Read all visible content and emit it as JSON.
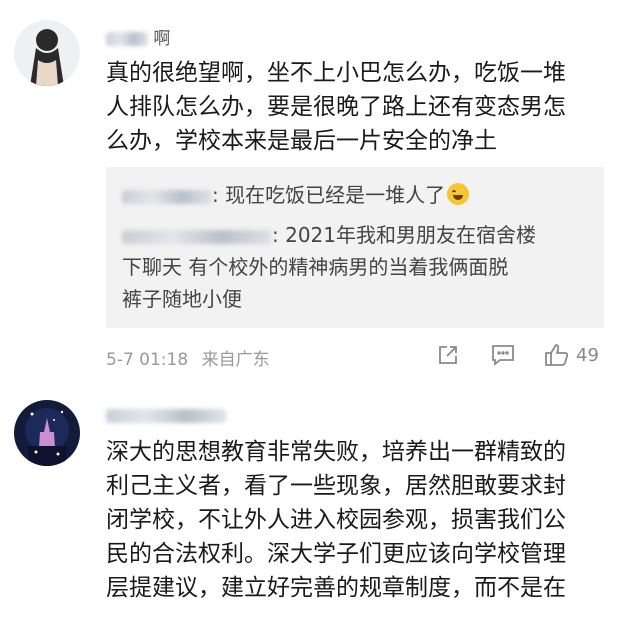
{
  "comments": [
    {
      "username": "啊",
      "text_lines": [
        "真的很绝望啊，坐不上小巴怎么办，吃饭一堆",
        "人排队怎么办，要是很晚了路上还有变态男怎",
        "么办，学校本来是最后一片安全的净土"
      ],
      "replies": [
        {
          "text": ": 现在吃饭已经是一堆人了"
        },
        {
          "lines": [
            ": 2021年我和男朋友在宿舍楼",
            "下聊天 有个校外的精神病男的当着我俩面脱",
            "裤子随地小便"
          ]
        }
      ],
      "timestamp": "5-7 01:18",
      "location": "来自广东",
      "likes": "49"
    },
    {
      "username": "",
      "text_lines": [
        "深大的思想教育非常失败，培养出一群精致的",
        "利己主义者，看了一些现象，居然胆敢要求封",
        "闭学校，不让外人进入校园参观，损害我们公",
        "民的合法权利。深大学子们更应该向学校管理",
        "层提建议，建立好完善的规章制度，而不是在"
      ]
    }
  ],
  "icons": {
    "share": "share-icon",
    "comment": "comment-icon",
    "like": "thumbs-up-icon",
    "emoji": "laughing-emoji-icon"
  }
}
